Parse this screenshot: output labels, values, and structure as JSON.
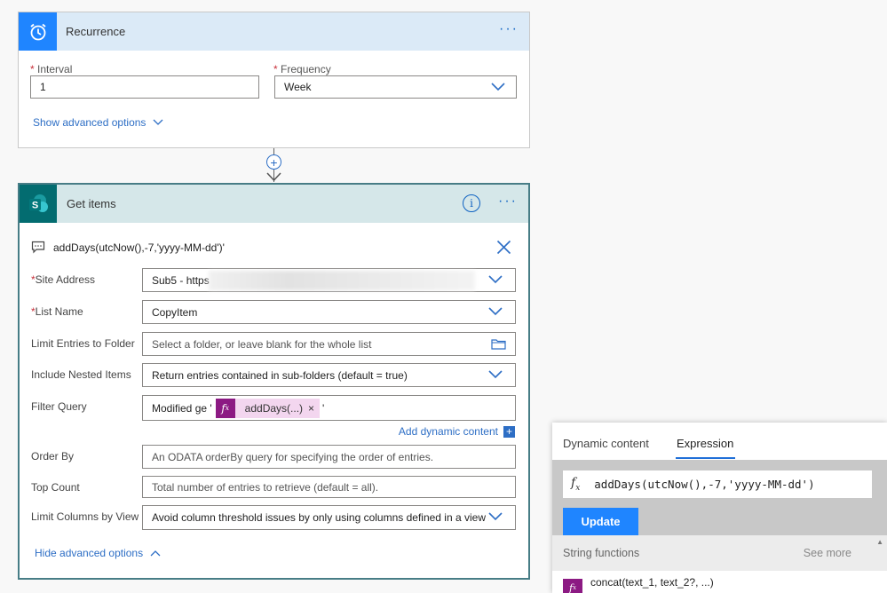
{
  "recurrence": {
    "title": "Recurrence",
    "more_label": "···",
    "interval": {
      "label": "Interval",
      "value": "1"
    },
    "frequency": {
      "label": "Frequency",
      "value": "Week"
    },
    "advanced_link": "Show advanced options"
  },
  "connector": {
    "plus": "+"
  },
  "get_items": {
    "title": "Get items",
    "info": "i",
    "more_label": "···",
    "comment": "addDays(utcNow(),-7,'yyyy-MM-dd')'",
    "fields": {
      "site_address": {
        "label": "Site Address",
        "value": "Sub5 - https"
      },
      "list_name": {
        "label": "List Name",
        "value": "CopyItem"
      },
      "limit_folder": {
        "label": "Limit Entries to Folder",
        "placeholder": "Select a folder, or leave blank for the whole list"
      },
      "nested": {
        "label": "Include Nested Items",
        "value": "Return entries contained in sub-folders (default = true)"
      },
      "filter": {
        "label": "Filter Query",
        "prefix": "Modified ge '",
        "token": "addDays(...)",
        "token_x": "×",
        "suffix": "'"
      },
      "order_by": {
        "label": "Order By",
        "placeholder": "An ODATA orderBy query for specifying the order of entries."
      },
      "top_count": {
        "label": "Top Count",
        "placeholder": "Total number of entries to retrieve (default = all)."
      },
      "limit_columns": {
        "label": "Limit Columns by View",
        "value": "Avoid column threshold issues by only using columns defined in a view"
      }
    },
    "add_dynamic": "Add dynamic content",
    "add_dynamic_plus": "+",
    "hide_advanced": "Hide advanced options"
  },
  "panel": {
    "tabs": [
      "Dynamic content",
      "Expression"
    ],
    "active_tab": "Expression",
    "fx": "fx",
    "expression": "addDays(utcNow(),-7,'yyyy-MM-dd')",
    "update_label": "Update",
    "section_title": "String functions",
    "see_more": "See more",
    "function_item": "concat(text_1, text_2?, ...)"
  },
  "colors": {
    "accent": "#1f85ff",
    "sharepoint": "#036c70",
    "token": "#8c1a83"
  }
}
